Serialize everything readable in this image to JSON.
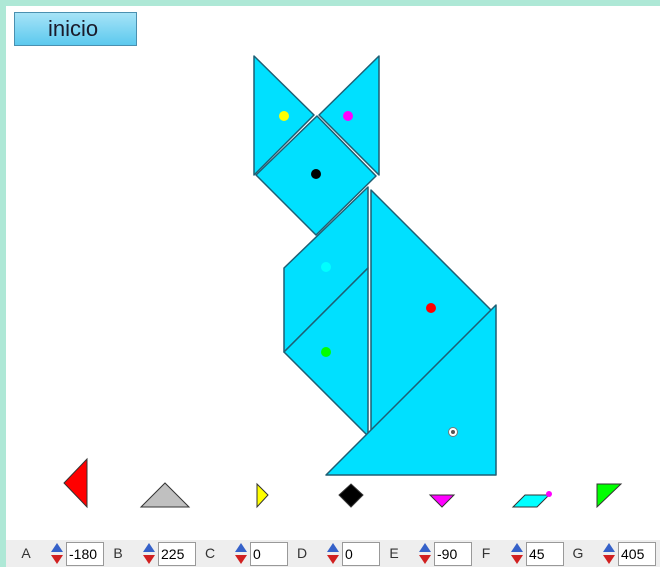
{
  "start_button": {
    "label": "inicio"
  },
  "controls": [
    {
      "label": "A",
      "value": "-180"
    },
    {
      "label": "B",
      "value": "225"
    },
    {
      "label": "C",
      "value": "0"
    },
    {
      "label": "D",
      "value": "0"
    },
    {
      "label": "E",
      "value": "-90"
    },
    {
      "label": "F",
      "value": "45"
    },
    {
      "label": "G",
      "value": "405"
    }
  ],
  "colors": {
    "piece_fill": "#00e0ff",
    "piece_stroke": "#1e5f74",
    "A": "#ff0000",
    "B": "#c0c0c0",
    "C": "#ffff00",
    "D": "#000000",
    "E": "#ff00ff",
    "F": "#00ffff",
    "G": "#00ff00"
  }
}
